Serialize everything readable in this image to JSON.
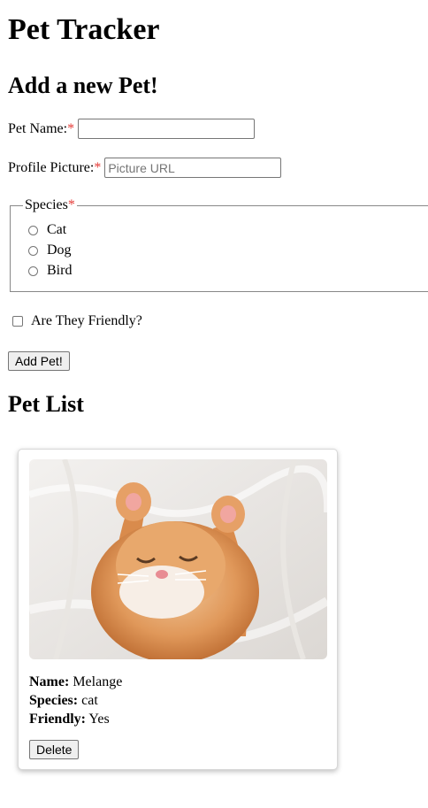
{
  "app": {
    "title": "Pet Tracker"
  },
  "form": {
    "heading": "Add a new Pet!",
    "required_marker": "*",
    "pet_name_label": "Pet Name:",
    "pet_name_value": "",
    "profile_picture_label": "Profile Picture:",
    "profile_picture_placeholder": "Picture URL",
    "species_legend": "Species",
    "species_options": [
      "Cat",
      "Dog",
      "Bird"
    ],
    "friendly_label": "Are They Friendly?",
    "friendly_checked": false,
    "submit_label": "Add Pet!"
  },
  "pet_list": {
    "heading": "Pet List",
    "pets": [
      {
        "image": "orange-kitten-photo",
        "name_label": "Name:",
        "name": "Melange",
        "species_label": "Species:",
        "species": "cat",
        "friendly_label": "Friendly:",
        "friendly": "Yes",
        "delete_label": "Delete"
      }
    ]
  },
  "colors": {
    "required": "#e53935",
    "button_bg": "#efefef",
    "border": "#767676"
  }
}
